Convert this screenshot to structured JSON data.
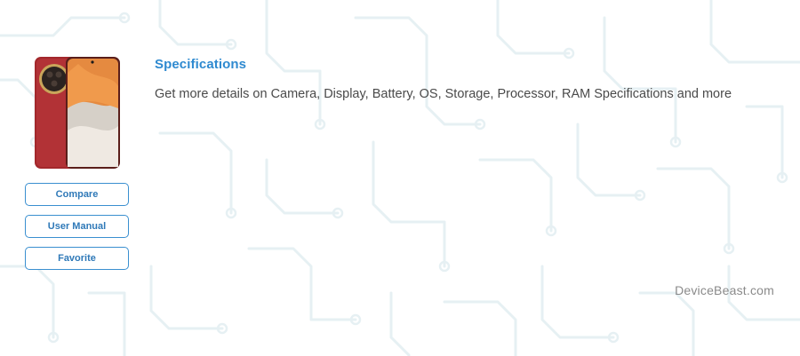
{
  "background": {
    "pattern": "circuit-traces",
    "line_color": "#e6f0f3"
  },
  "product": {
    "image_icon": "smartphone-image",
    "body_color": "#a3282c",
    "screen_color": "#e58a40"
  },
  "actions": {
    "compare_label": "Compare",
    "user_manual_label": "User Manual",
    "favorite_label": "Favorite"
  },
  "section": {
    "title": "Specifications",
    "description": "Get more details on Camera, Display, Battery, OS, Storage, Processor, RAM Specifications and more"
  },
  "footer": {
    "brand": "DeviceBeast.com"
  },
  "colors": {
    "accent": "#2f8ad0",
    "button_border": "#3a8fd0",
    "text": "#4a4a4a",
    "watermark": "#8a8a8a"
  }
}
